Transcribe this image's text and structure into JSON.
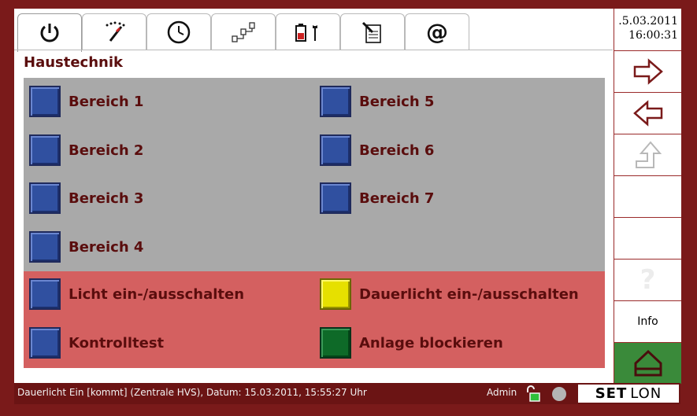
{
  "header": {
    "title": "Haustechnik",
    "date": ".5.03.2011",
    "time": "16:00:31"
  },
  "tabs": [
    {
      "name": "power-icon"
    },
    {
      "name": "magic-wand-icon"
    },
    {
      "name": "clock-icon"
    },
    {
      "name": "network-icon"
    },
    {
      "name": "battery-wrench-icon"
    },
    {
      "name": "document-pen-icon"
    },
    {
      "name": "at-icon"
    }
  ],
  "areas": [
    {
      "label": "Bereich 1"
    },
    {
      "label": "Bereich 2"
    },
    {
      "label": "Bereich 3"
    },
    {
      "label": "Bereich 4"
    },
    {
      "label": "Bereich 5"
    },
    {
      "label": "Bereich 6"
    },
    {
      "label": "Bereich 7"
    }
  ],
  "actions": [
    {
      "label": "Licht ein-/ausschalten",
      "color": "#3050a0"
    },
    {
      "label": "Kontrolltest",
      "color": "#3050a0"
    },
    {
      "label": "Dauerlicht ein-/ausschalten",
      "color": "#e6e000"
    },
    {
      "label": "Anlage blockieren",
      "color": "#0e6a28"
    }
  ],
  "sidebar": {
    "question": "?",
    "info": "Info"
  },
  "status": {
    "message": "Dauerlicht Ein [kommt] (Zentrale HVS), Datum: 15.03.2011, 15:55:27 Uhr",
    "user": "Admin",
    "logo_a": "SET",
    "logo_b": "LON"
  },
  "colors": {
    "frame": "#7a1a1a",
    "grey_panel": "#a9a9a9",
    "red_panel": "#d46060",
    "text": "#5a0d0d"
  }
}
